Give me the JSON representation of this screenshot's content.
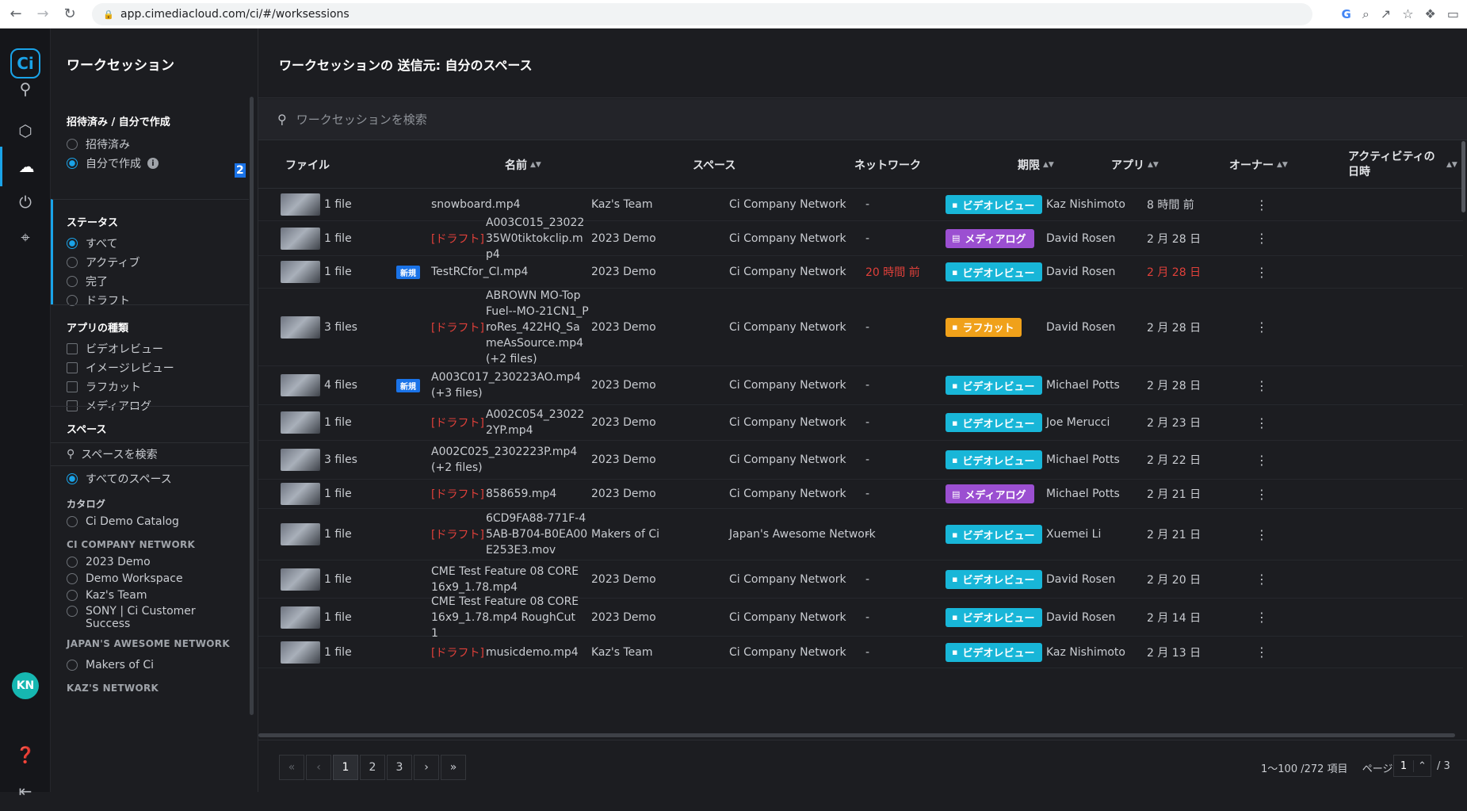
{
  "browser": {
    "url": "app.cimediacloud.com/ci/#/worksessions"
  },
  "rail": {
    "logo": "Ci",
    "avatar": "KN"
  },
  "filters": {
    "title": "ワークセッション",
    "invite_section": {
      "heading": "招待済み / 自分で作成",
      "options": [
        "招待済み",
        "自分で作成"
      ],
      "selected": "自分で作成",
      "count": "2"
    },
    "status_section": {
      "heading": "ステータス",
      "options": [
        "すべて",
        "アクティブ",
        "完了",
        "ドラフト"
      ],
      "selected": "すべて"
    },
    "app_type_section": {
      "heading": "アプリの種類",
      "options": [
        "ビデオレビュー",
        "イメージレビュー",
        "ラフカット",
        "メディアログ"
      ]
    },
    "space_section": {
      "heading": "スペース",
      "search_placeholder": "スペースを検索",
      "all_spaces": "すべてのスペース",
      "catalog_heading": "カタログ",
      "catalog_items": [
        "Ci Demo Catalog"
      ],
      "network1_heading": "CI COMPANY NETWORK",
      "network1_items": [
        "2023 Demo",
        "Demo Workspace",
        "Kaz's Team",
        "SONY | Ci Customer Success"
      ],
      "network2_heading": "JAPAN'S AWESOME NETWORK",
      "network2_items": [
        "Makers of Ci"
      ],
      "network3_heading": "KAZ'S NETWORK"
    }
  },
  "main": {
    "title": "ワークセッションの 送信元: 自分のスペース",
    "search_placeholder": "ワークセッションを検索",
    "columns": {
      "file": "ファイル",
      "name": "名前",
      "space": "スペース",
      "network": "ネットワーク",
      "deadline": "期限",
      "app": "アプリ",
      "owner": "オーナー",
      "activity": "アクティビティの日時"
    },
    "draft_label": "[ドラフト]",
    "new_label": "新規",
    "rows": [
      {
        "files": "1 file",
        "name": "snowboard.mp4",
        "space": "Kaz's Team",
        "network": "Ci Company Network",
        "deadline": "-",
        "app": "ビデオレビュー",
        "owner": "Kaz Nishimoto",
        "activity": "8 時間 前"
      },
      {
        "files": "1 file",
        "name": "A003C015_2302235W0tiktokclip.mp4",
        "space": "2023 Demo",
        "network": "Ci Company Network",
        "deadline": "-",
        "app": "メディアログ",
        "owner": "David Rosen",
        "activity": "2 月 28 日"
      },
      {
        "files": "1 file",
        "name": "TestRCfor_CI.mp4",
        "space": "2023 Demo",
        "network": "Ci Company Network",
        "deadline": "20 時間 前",
        "app": "ビデオレビュー",
        "owner": "David Rosen",
        "activity": "2 月 28 日"
      },
      {
        "files": "3 files",
        "name": "ABROWN MO-Top Fuel--MO-21CN1_ProRes_422HQ_SameAsSource.mp4 (+2 files)",
        "space": "2023 Demo",
        "network": "Ci Company Network",
        "deadline": "-",
        "app": "ラフカット",
        "owner": "David Rosen",
        "activity": "2 月 28 日"
      },
      {
        "files": "4 files",
        "name": "A003C017_230223AO.mp4 (+3 files)",
        "space": "2023 Demo",
        "network": "Ci Company Network",
        "deadline": "-",
        "app": "ビデオレビュー",
        "owner": "Michael Potts",
        "activity": "2 月 28 日"
      },
      {
        "files": "1 file",
        "name": "A002C054_230222YP.mp4",
        "space": "2023 Demo",
        "network": "Ci Company Network",
        "deadline": "-",
        "app": "ビデオレビュー",
        "owner": "Joe Merucci",
        "activity": "2 月 23 日"
      },
      {
        "files": "3 files",
        "name": "A002C025_2302223P.mp4 (+2 files)",
        "space": "2023 Demo",
        "network": "Ci Company Network",
        "deadline": "-",
        "app": "ビデオレビュー",
        "owner": "Michael Potts",
        "activity": "2 月 22 日"
      },
      {
        "files": "1 file",
        "name": "858659.mp4",
        "space": "2023 Demo",
        "network": "Ci Company Network",
        "deadline": "-",
        "app": "メディアログ",
        "owner": "Michael Potts",
        "activity": "2 月 21 日"
      },
      {
        "files": "1 file",
        "name": "6CD9FA88-771F-45AB-B704-B0EA00E253E3.mov",
        "space": "Makers of Ci",
        "network": "Japan's Awesome Network",
        "deadline": "-",
        "app": "ビデオレビュー",
        "owner": "Xuemei Li",
        "activity": "2 月 21 日"
      },
      {
        "files": "1 file",
        "name": "CME Test Feature 08 CORE 16x9_1.78.mp4",
        "space": "2023 Demo",
        "network": "Ci Company Network",
        "deadline": "-",
        "app": "ビデオレビュー",
        "owner": "David Rosen",
        "activity": "2 月 20 日"
      },
      {
        "files": "1 file",
        "name": "CME Test Feature 08 CORE 16x9_1.78.mp4 RoughCut 1",
        "space": "2023 Demo",
        "network": "Ci Company Network",
        "deadline": "-",
        "app": "ビデオレビュー",
        "owner": "David Rosen",
        "activity": "2 月 14 日"
      },
      {
        "files": "1 file",
        "name": "musicdemo.mp4",
        "space": "Kaz's Team",
        "network": "Ci Company Network",
        "deadline": "-",
        "app": "ビデオレビュー",
        "owner": "Kaz Nishimoto",
        "activity": "2 月 13 日"
      }
    ]
  },
  "pagination": {
    "pages": [
      "1",
      "2",
      "3"
    ],
    "current": "1",
    "range": "1〜100 /272 項目",
    "page_label": "ページ",
    "page_input": "1",
    "total": "/ 3"
  }
}
